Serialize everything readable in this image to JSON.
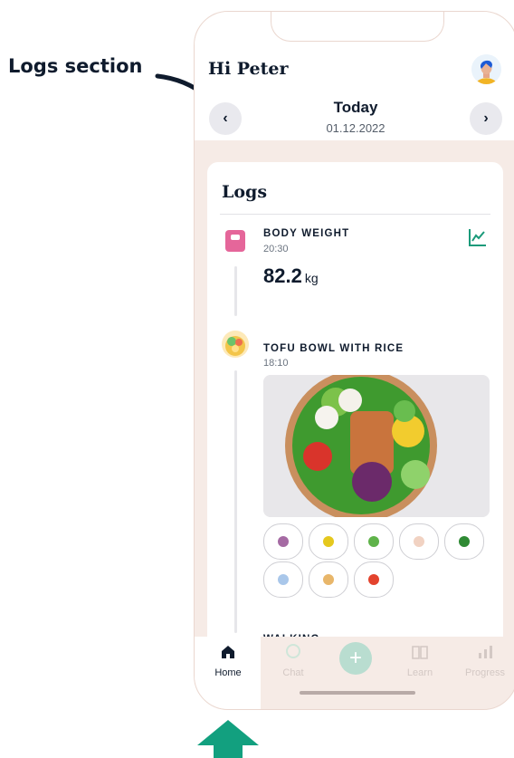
{
  "annotation": {
    "label": "Logs section"
  },
  "header": {
    "greeting": "Hi Peter",
    "date_title": "Today",
    "date_value": "01.12.2022",
    "prev_icon": "chevron-left-icon",
    "next_icon": "chevron-right-icon"
  },
  "logs": {
    "title": "Logs",
    "entries": [
      {
        "title": "BODY WEIGHT",
        "time": "20:30",
        "value": "82.2",
        "unit": "kg",
        "icon": "scale-icon"
      },
      {
        "title": "TOFU BOWL WITH RICE",
        "time": "18:10",
        "icon": "bowl-icon",
        "ingredients": [
          "beans-icon",
          "corn-icon",
          "cucumber-icon",
          "egg-icon",
          "spinach-icon",
          "rice-icon",
          "tofu-icon",
          "tomato-icon"
        ]
      },
      {
        "title": "WALKING"
      }
    ]
  },
  "tabs": [
    {
      "label": "Home",
      "icon": "home-icon",
      "active": true
    },
    {
      "label": "Chat",
      "icon": "chat-icon",
      "active": false
    },
    {
      "label": "",
      "icon": "plus-icon",
      "active": false
    },
    {
      "label": "Learn",
      "icon": "book-icon",
      "active": false
    },
    {
      "label": "Progress",
      "icon": "bar-chart-icon",
      "active": false
    }
  ],
  "colors": {
    "accent": "#1a9a7a",
    "background": "#f6ebe6",
    "text": "#0f1b2d",
    "arrow_up": "#12a07f"
  }
}
